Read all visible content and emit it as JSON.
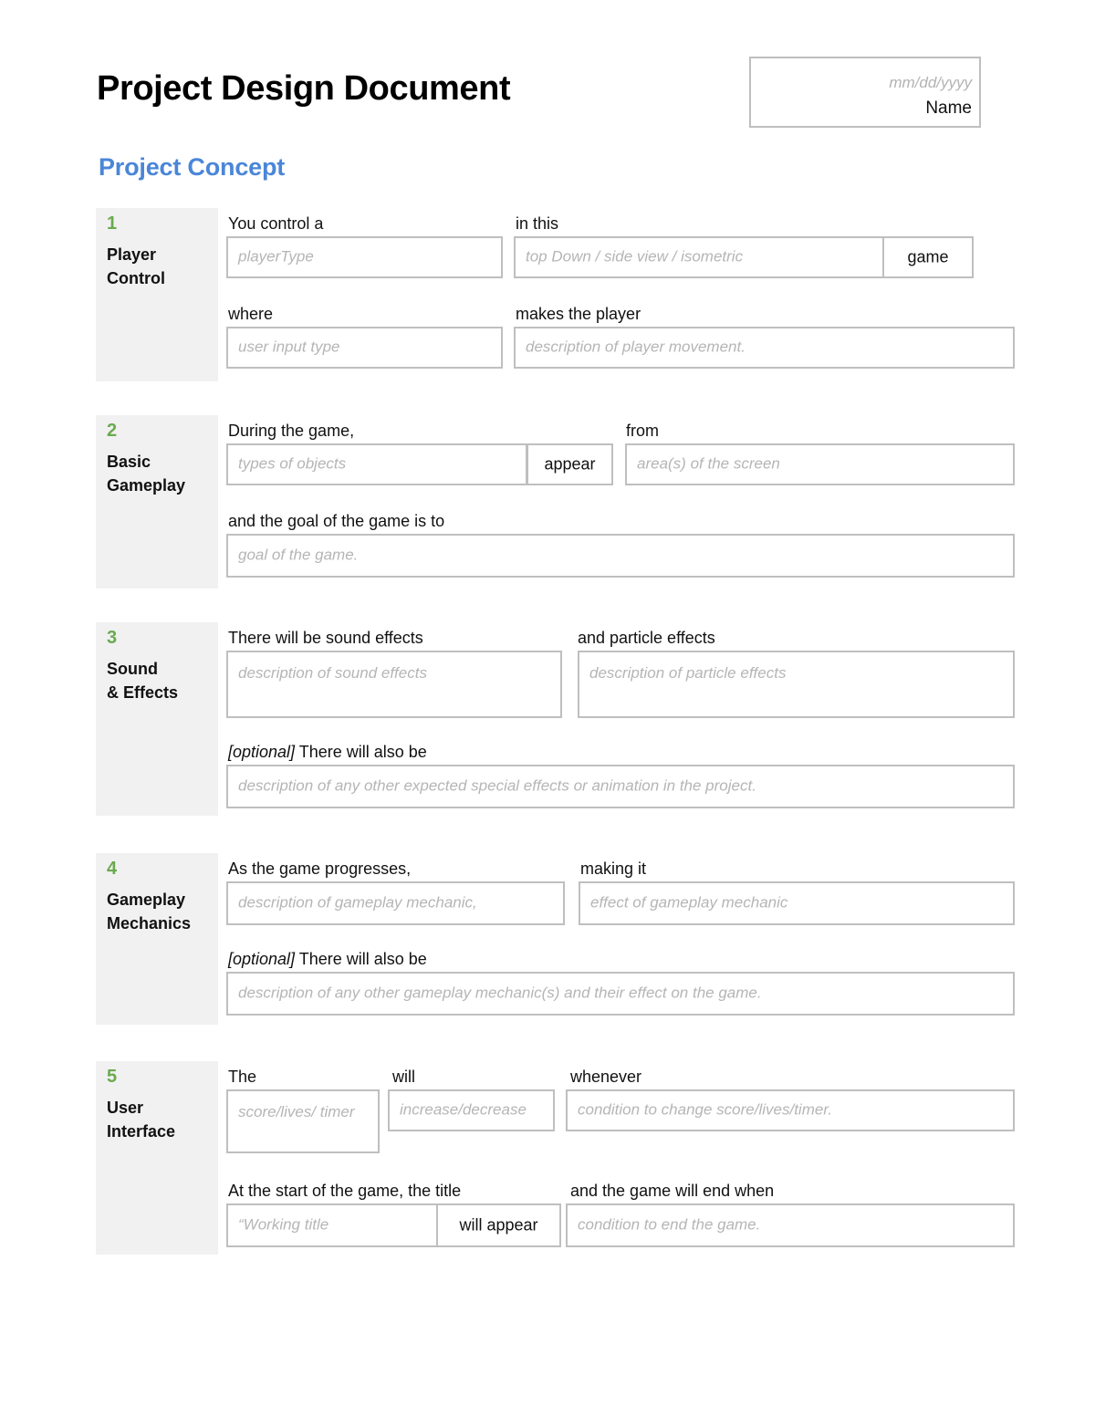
{
  "document": {
    "title": "Project Design Document",
    "name_block": {
      "date_placeholder": "mm/dd/yyyy",
      "name_label": "Name"
    },
    "section_heading": "Project Concept"
  },
  "colors": {
    "heading_blue": "#4a86d8",
    "number_green": "#6aaa4f",
    "sidebar_gray": "#f1f1f1",
    "box_border": "#bfbfbf",
    "placeholder_gray": "#b5b5b5"
  },
  "sections": [
    {
      "number": "1",
      "name": "Player\nControl",
      "name_line1": "Player",
      "name_line2": "Control",
      "labels": {
        "l1": "You control a",
        "l2": "in this",
        "l3": "where",
        "l4": "makes the player"
      },
      "fields": {
        "player_type": "playerType",
        "view_type": "top Down / side view / isometric",
        "game_word": "game",
        "user_input": "user input type",
        "player_movement": "description of player movement."
      }
    },
    {
      "number": "2",
      "name_line1": "Basic",
      "name_line2": "Gameplay",
      "labels": {
        "l1": "During the game,",
        "l2": "from",
        "l3": "and the goal of the game is to"
      },
      "fields": {
        "object_types": "types of objects",
        "appear_word": "appear",
        "screen_areas": "area(s) of the screen",
        "goal": "goal of the game."
      }
    },
    {
      "number": "3",
      "name_line1": "Sound",
      "name_line2": "& Effects",
      "labels": {
        "l1": "There will be sound effects",
        "l2": "and particle effects",
        "l3_optional": "[optional]",
        "l3_rest": " There will also be"
      },
      "fields": {
        "sound_effects": "description of sound effects",
        "particle_effects": "description of particle effects",
        "other_effects": "description of any other expected special effects or animation in the project."
      }
    },
    {
      "number": "4",
      "name_line1": "Gameplay",
      "name_line2": "Mechanics",
      "labels": {
        "l1": "As the game progresses,",
        "l2": "making it",
        "l3_optional": "[optional]",
        "l3_rest": " There will also be"
      },
      "fields": {
        "mechanic": "description of gameplay mechanic,",
        "mechanic_effect": "effect of gameplay mechanic",
        "other_mechanics": "description of any other gameplay mechanic(s) and their effect on the game."
      }
    },
    {
      "number": "5",
      "name_line1": "User",
      "name_line2": "Interface",
      "labels": {
        "l1": "The",
        "l2": "will",
        "l3": "whenever",
        "l4": "At the start of the game, the title",
        "l5": "and the game will end when"
      },
      "fields": {
        "ui_element": "score/lives/ timer",
        "change_direction": "increase/decrease",
        "change_condition": "condition to change score/lives/timer.",
        "working_title": "“Working title",
        "will_appear_word": "will appear",
        "end_condition": "condition to end the game."
      }
    }
  ]
}
